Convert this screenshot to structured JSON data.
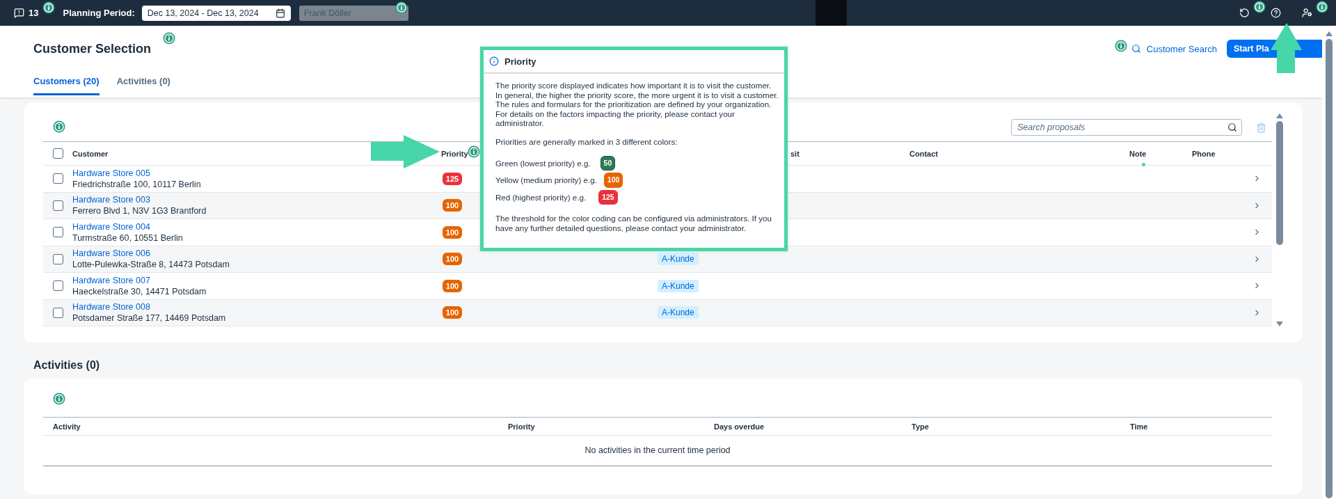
{
  "top_bar": {
    "notifications": "13",
    "planning_label": "Planning Period:",
    "date_range": "Dec 13, 2024 - Dec 13, 2024",
    "user": "Frank Döller"
  },
  "header": {
    "title": "Customer Selection",
    "search_link": "Customer Search",
    "start_button": "Start Pla"
  },
  "tabs": [
    {
      "label": "Customers (20)",
      "selected": true
    },
    {
      "label": "Activities (0)",
      "selected": false
    }
  ],
  "customers": {
    "search": {
      "placeholder": "Search proposals"
    },
    "select_all_checked": false,
    "columns": [
      "Customer",
      "Priority",
      "sit",
      "Contact",
      "Note",
      "Phone"
    ],
    "rows": [
      {
        "name": "Hardware Store 005",
        "address": "Friedrichstraße 100, 10117 Berlin",
        "priority": "125",
        "color": "#e9323c",
        "checked": false
      },
      {
        "name": "Hardware Store 003",
        "address": "Ferrero Blvd 1, N3V 1G3 Brantford",
        "priority": "100",
        "color": "#e76500",
        "checked": false
      },
      {
        "name": "Hardware Store 004",
        "address": "Turmstraße 60, 10551 Berlin",
        "priority": "100",
        "color": "#e76500",
        "checked": false
      },
      {
        "name": "Hardware Store 006",
        "address": "Lotte-Pulewka-Straße 8, 14473 Potsdam",
        "priority": "100",
        "color": "#e76500",
        "tag": "A-Kunde",
        "checked": false
      },
      {
        "name": "Hardware Store 007",
        "address": "Haeckelstraße 30, 14471 Potsdam",
        "priority": "100",
        "color": "#e76500",
        "tag": "A-Kunde",
        "checked": false
      },
      {
        "name": "Hardware Store 008",
        "address": "Potsdamer Straße 177, 14469 Potsdam",
        "priority": "100",
        "color": "#e76500",
        "tag": "A-Kunde",
        "checked": false
      }
    ]
  },
  "priority_popover": {
    "title": "Priority",
    "paragraphs": [
      "The priority score displayed indicates how important it is to visit the customer. In general, the higher the priority score, the more urgent it is to visit a customer. The rules and formulars for the prioritization are defined by your organization. For details on the factors impacting the priority, please contact your administrator.",
      "Priorities are generally marked in 3 different colors:"
    ],
    "legend": [
      {
        "label": "Green (lowest priority) e.g.",
        "value": "50",
        "color": "#2b7d4f"
      },
      {
        "label": "Yellow (medium priority) e.g.",
        "value": "100",
        "color": "#e76500"
      },
      {
        "label": "Red (highest priority) e.g.",
        "value": "125",
        "color": "#e9323c"
      }
    ],
    "footer": "The threshold for the color coding can be configured via administrators. If you have any further detailed questions, please contact your administrator."
  },
  "activities": {
    "title": "Activities (0)",
    "columns": [
      "Activity",
      "Priority",
      "Days overdue",
      "Type",
      "Time"
    ],
    "empty_text": "No activities in the current time period"
  }
}
